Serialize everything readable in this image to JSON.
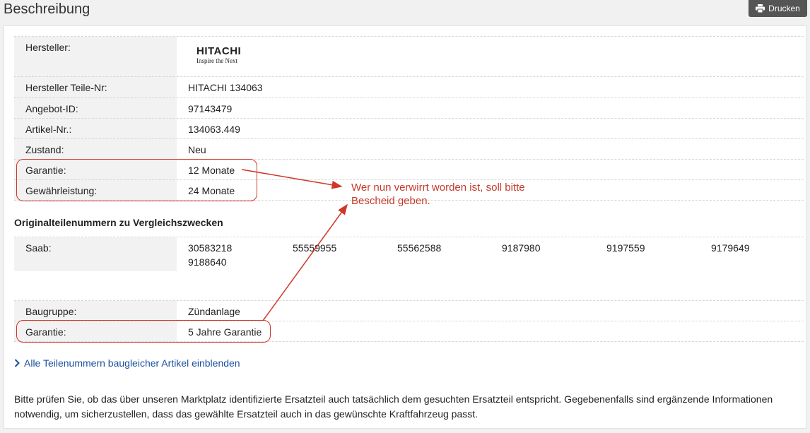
{
  "header": {
    "title": "Beschreibung",
    "print_label": "Drucken"
  },
  "details": [
    {
      "label": "Hersteller:",
      "logo": {
        "name": "HITACHI",
        "tagline": "Inspire the Next"
      }
    },
    {
      "label": "Hersteller Teile-Nr:",
      "value": "HITACHI 134063"
    },
    {
      "label": "Angebot-ID:",
      "value": "97143479"
    },
    {
      "label": "Artikel-Nr.:",
      "value": "134063.449"
    },
    {
      "label": "Zustand:",
      "value": "Neu"
    },
    {
      "label": "Garantie:",
      "value": "12 Monate"
    },
    {
      "label": "Gewährleistung:",
      "value": "24 Monate"
    }
  ],
  "oe_section": {
    "heading": "Originalteilenummern zu Vergleichszwecken",
    "brand": "Saab:",
    "numbers": [
      "30583218",
      "55559955",
      "55562588",
      "9187980",
      "9197559",
      "9179649",
      "9188640"
    ]
  },
  "extra": [
    {
      "label": "Baugruppe:",
      "value": "Zündanlage"
    },
    {
      "label": "Garantie:",
      "value": "5 Jahre Garantie"
    }
  ],
  "show_link": "Alle Teilenummern baugleicher Artikel einblenden",
  "disclaimer": "Bitte prüfen Sie, ob das über unseren Marktplatz identifizierte Ersatzteil auch tatsächlich dem gesuchten Ersatzteil entspricht. Gegebenenfalls sind ergänzende Informationen notwendig, um sicherzustellen, dass das gewählte Ersatzteil auch in das gewünschte Kraftfahrzeug passt.",
  "annotation": {
    "line1": "Wer nun verwirrt worden ist, soll bitte",
    "line2": "Bescheid geben.",
    "color": "#c7392b"
  },
  "colors": {
    "link": "#1a4f9c",
    "label_bg": "#f2f2f2",
    "button_bg": "#555555"
  }
}
